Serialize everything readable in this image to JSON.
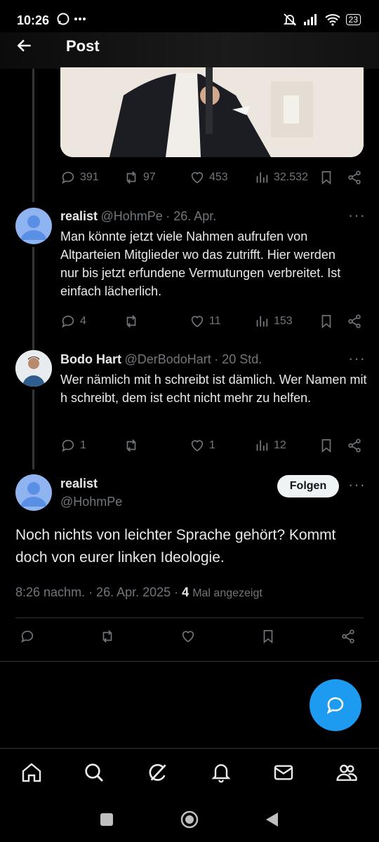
{
  "status": {
    "time": "10:26",
    "battery": "23"
  },
  "header": {
    "title": "Post"
  },
  "parent_post": {
    "replies": "391",
    "reposts": "97",
    "likes": "453",
    "views": "32.532"
  },
  "replies": [
    {
      "name": "realist",
      "handle": "@HohmPe",
      "time": "· 26. Apr.",
      "text": "Man könnte jetzt viele Nahmen aufrufen von Altparteien Mitglieder wo das zutrifft. Hier werden nur bis jetzt erfundene Vermutungen verbreitet. Ist einfach lächerlich.",
      "replies": "4",
      "reposts": "",
      "likes": "11",
      "views": "153"
    },
    {
      "name": "Bodo Hart",
      "handle": "@DerBodoHart",
      "time": "· 20 Std.",
      "text": "Wer nämlich mit h schreibt ist dämlich. Wer Namen mit h schreibt, dem ist echt nicht mehr zu helfen.",
      "replies": "1",
      "reposts": "",
      "likes": "1",
      "views": "12"
    }
  ],
  "main_post": {
    "name": "realist",
    "handle": "@HohmPe",
    "follow_label": "Folgen",
    "text": "Noch nichts von leichter Sprache gehört? Kommt doch von eurer linken Ideologie.",
    "datetime": "8:26 nachm. · 26. Apr. 2025 ·",
    "views_count": "4",
    "views_label": "Mal angezeigt"
  },
  "icons": {
    "nav": [
      "home-icon",
      "search-icon",
      "grok-icon",
      "notifications-icon",
      "messages-icon",
      "communities-icon"
    ],
    "actions": [
      "reply-icon",
      "repost-icon",
      "like-icon",
      "views-icon",
      "bookmark-icon",
      "share-icon"
    ]
  },
  "colors": {
    "accent": "#1d9bf0",
    "muted": "#71767b",
    "bg": "#000000"
  }
}
